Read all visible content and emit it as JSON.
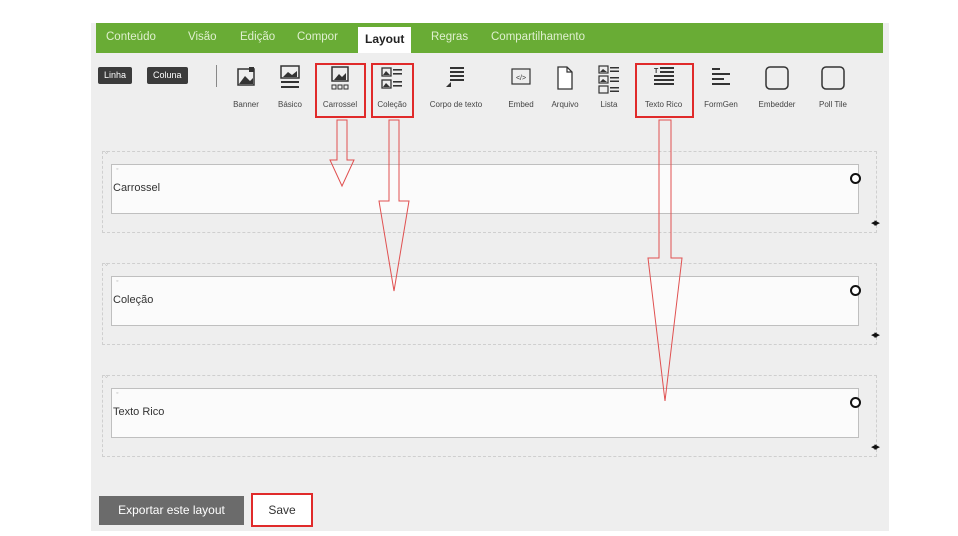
{
  "tabs": [
    {
      "label": "Conteúdo",
      "active": false
    },
    {
      "label": "Visão",
      "active": false
    },
    {
      "label": "Edição",
      "active": false
    },
    {
      "label": "Compor",
      "active": false
    },
    {
      "label": "Layout",
      "active": true
    },
    {
      "label": "Regras",
      "active": false
    },
    {
      "label": "Compartilhamento",
      "active": false
    }
  ],
  "toolbar": {
    "row_button": "Linha",
    "column_button": "Coluna",
    "tools": {
      "banner": "Banner",
      "basicos": "Básico",
      "carrossel": "Carrossel",
      "colecao": "Coleção",
      "corpo": "Corpo de texto",
      "embed": "Embed",
      "arquivo": "Arquivo",
      "lista": "Lista",
      "texto_rico": "Texto Rico",
      "formgen": "FormGen",
      "embedder": "Embedder",
      "poll_tile": "Poll Tile"
    },
    "highlighted_tools": [
      "Carrossel",
      "Coleção",
      "Texto Rico"
    ]
  },
  "rows": [
    {
      "tile_title": "Carrossel"
    },
    {
      "tile_title": "Coleção"
    },
    {
      "tile_title": "Texto Rico"
    }
  ],
  "footer": {
    "export_label": "Exportar este layout",
    "save_label": "Save"
  },
  "colors": {
    "tab_bar": "#69ac35",
    "highlight": "#e02a2a",
    "panel": "#eeeeee"
  }
}
